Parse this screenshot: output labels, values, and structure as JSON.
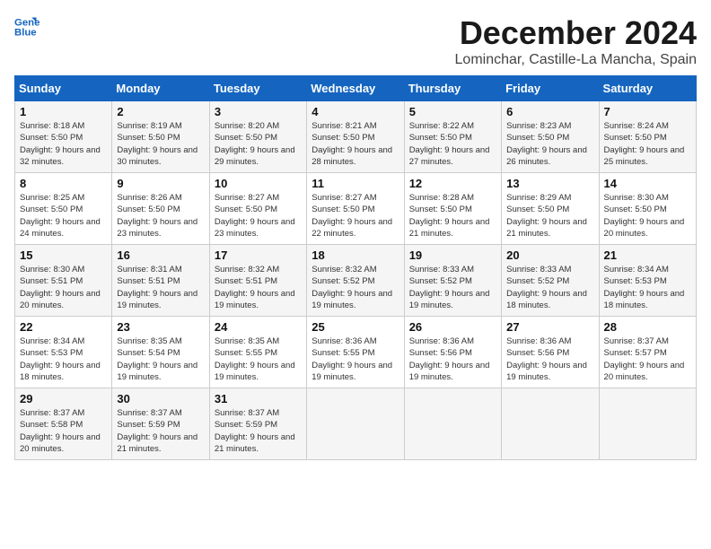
{
  "logo": {
    "line1": "General",
    "line2": "Blue"
  },
  "title": "December 2024",
  "subtitle": "Lominchar, Castille-La Mancha, Spain",
  "headers": [
    "Sunday",
    "Monday",
    "Tuesday",
    "Wednesday",
    "Thursday",
    "Friday",
    "Saturday"
  ],
  "weeks": [
    [
      {
        "day": "1",
        "sunrise": "8:18 AM",
        "sunset": "5:50 PM",
        "daylight": "9 hours and 32 minutes."
      },
      {
        "day": "2",
        "sunrise": "8:19 AM",
        "sunset": "5:50 PM",
        "daylight": "9 hours and 30 minutes."
      },
      {
        "day": "3",
        "sunrise": "8:20 AM",
        "sunset": "5:50 PM",
        "daylight": "9 hours and 29 minutes."
      },
      {
        "day": "4",
        "sunrise": "8:21 AM",
        "sunset": "5:50 PM",
        "daylight": "9 hours and 28 minutes."
      },
      {
        "day": "5",
        "sunrise": "8:22 AM",
        "sunset": "5:50 PM",
        "daylight": "9 hours and 27 minutes."
      },
      {
        "day": "6",
        "sunrise": "8:23 AM",
        "sunset": "5:50 PM",
        "daylight": "9 hours and 26 minutes."
      },
      {
        "day": "7",
        "sunrise": "8:24 AM",
        "sunset": "5:50 PM",
        "daylight": "9 hours and 25 minutes."
      }
    ],
    [
      {
        "day": "8",
        "sunrise": "8:25 AM",
        "sunset": "5:50 PM",
        "daylight": "9 hours and 24 minutes."
      },
      {
        "day": "9",
        "sunrise": "8:26 AM",
        "sunset": "5:50 PM",
        "daylight": "9 hours and 23 minutes."
      },
      {
        "day": "10",
        "sunrise": "8:27 AM",
        "sunset": "5:50 PM",
        "daylight": "9 hours and 23 minutes."
      },
      {
        "day": "11",
        "sunrise": "8:27 AM",
        "sunset": "5:50 PM",
        "daylight": "9 hours and 22 minutes."
      },
      {
        "day": "12",
        "sunrise": "8:28 AM",
        "sunset": "5:50 PM",
        "daylight": "9 hours and 21 minutes."
      },
      {
        "day": "13",
        "sunrise": "8:29 AM",
        "sunset": "5:50 PM",
        "daylight": "9 hours and 21 minutes."
      },
      {
        "day": "14",
        "sunrise": "8:30 AM",
        "sunset": "5:50 PM",
        "daylight": "9 hours and 20 minutes."
      }
    ],
    [
      {
        "day": "15",
        "sunrise": "8:30 AM",
        "sunset": "5:51 PM",
        "daylight": "9 hours and 20 minutes."
      },
      {
        "day": "16",
        "sunrise": "8:31 AM",
        "sunset": "5:51 PM",
        "daylight": "9 hours and 19 minutes."
      },
      {
        "day": "17",
        "sunrise": "8:32 AM",
        "sunset": "5:51 PM",
        "daylight": "9 hours and 19 minutes."
      },
      {
        "day": "18",
        "sunrise": "8:32 AM",
        "sunset": "5:52 PM",
        "daylight": "9 hours and 19 minutes."
      },
      {
        "day": "19",
        "sunrise": "8:33 AM",
        "sunset": "5:52 PM",
        "daylight": "9 hours and 19 minutes."
      },
      {
        "day": "20",
        "sunrise": "8:33 AM",
        "sunset": "5:52 PM",
        "daylight": "9 hours and 18 minutes."
      },
      {
        "day": "21",
        "sunrise": "8:34 AM",
        "sunset": "5:53 PM",
        "daylight": "9 hours and 18 minutes."
      }
    ],
    [
      {
        "day": "22",
        "sunrise": "8:34 AM",
        "sunset": "5:53 PM",
        "daylight": "9 hours and 18 minutes."
      },
      {
        "day": "23",
        "sunrise": "8:35 AM",
        "sunset": "5:54 PM",
        "daylight": "9 hours and 19 minutes."
      },
      {
        "day": "24",
        "sunrise": "8:35 AM",
        "sunset": "5:55 PM",
        "daylight": "9 hours and 19 minutes."
      },
      {
        "day": "25",
        "sunrise": "8:36 AM",
        "sunset": "5:55 PM",
        "daylight": "9 hours and 19 minutes."
      },
      {
        "day": "26",
        "sunrise": "8:36 AM",
        "sunset": "5:56 PM",
        "daylight": "9 hours and 19 minutes."
      },
      {
        "day": "27",
        "sunrise": "8:36 AM",
        "sunset": "5:56 PM",
        "daylight": "9 hours and 19 minutes."
      },
      {
        "day": "28",
        "sunrise": "8:37 AM",
        "sunset": "5:57 PM",
        "daylight": "9 hours and 20 minutes."
      }
    ],
    [
      {
        "day": "29",
        "sunrise": "8:37 AM",
        "sunset": "5:58 PM",
        "daylight": "9 hours and 20 minutes."
      },
      {
        "day": "30",
        "sunrise": "8:37 AM",
        "sunset": "5:59 PM",
        "daylight": "9 hours and 21 minutes."
      },
      {
        "day": "31",
        "sunrise": "8:37 AM",
        "sunset": "5:59 PM",
        "daylight": "9 hours and 21 minutes."
      },
      null,
      null,
      null,
      null
    ]
  ]
}
